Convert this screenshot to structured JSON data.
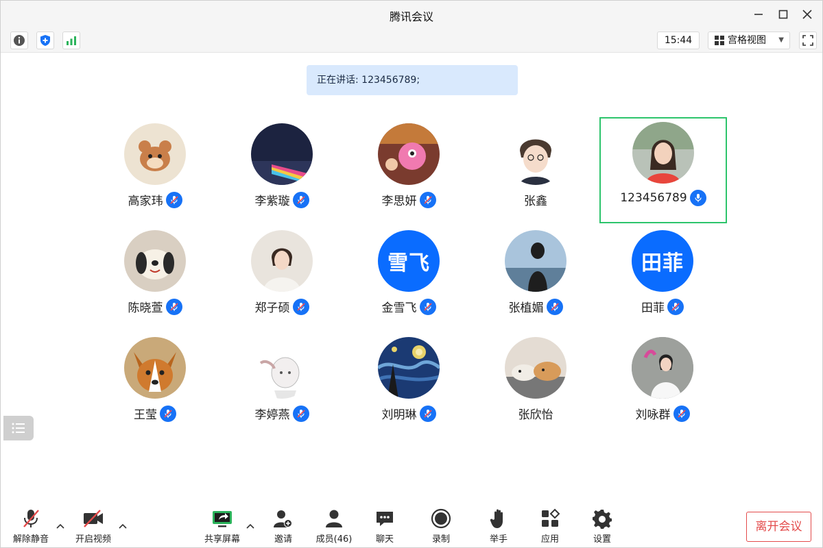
{
  "window": {
    "title": "腾讯会议"
  },
  "toolbar": {
    "info_icon": "info-icon",
    "security_icon": "shield-icon",
    "signal_icon": "signal-icon",
    "time": "15:44",
    "view_mode": "宫格视图",
    "colors": {
      "signal": "#2bb35b",
      "shield": "#1772f6"
    }
  },
  "banner": {
    "speaking": "正在讲话: 123456789;"
  },
  "participants": [
    {
      "name": "高家玮",
      "muted": true,
      "avatar": "image"
    },
    {
      "name": "李紫璇",
      "muted": true,
      "avatar": "image"
    },
    {
      "name": "李思妍",
      "muted": true,
      "avatar": "image"
    },
    {
      "name": "张鑫",
      "muted": null,
      "avatar": "image"
    },
    {
      "name": "123456789",
      "muted": false,
      "avatar": "image",
      "active": true
    },
    {
      "name": "陈晓萱",
      "muted": true,
      "avatar": "image"
    },
    {
      "name": "郑子硕",
      "muted": true,
      "avatar": "image"
    },
    {
      "name": "金雪飞",
      "muted": true,
      "avatar": "text",
      "avatar_text": "雪飞"
    },
    {
      "name": "张植媚",
      "muted": true,
      "avatar": "image"
    },
    {
      "name": "田菲",
      "muted": true,
      "avatar": "text",
      "avatar_text": "田菲"
    },
    {
      "name": "王莹",
      "muted": true,
      "avatar": "image"
    },
    {
      "name": "李婷燕",
      "muted": true,
      "avatar": "image"
    },
    {
      "name": "刘明琳",
      "muted": true,
      "avatar": "image"
    },
    {
      "name": "张欣怡",
      "muted": null,
      "avatar": "image"
    },
    {
      "name": "刘咏群",
      "muted": true,
      "avatar": "image"
    }
  ],
  "bottom": {
    "unmute": "解除静音",
    "video": "开启视频",
    "share": "共享屏幕",
    "invite": "邀请",
    "members": "成员(46)",
    "chat": "聊天",
    "record": "录制",
    "raise_hand": "举手",
    "apps": "应用",
    "settings": "设置",
    "leave": "离开会议"
  },
  "colors": {
    "accent": "#1772f6",
    "active_border": "#2cc46b",
    "leave": "#e34a4a",
    "muted_red": "#e34a4a"
  }
}
